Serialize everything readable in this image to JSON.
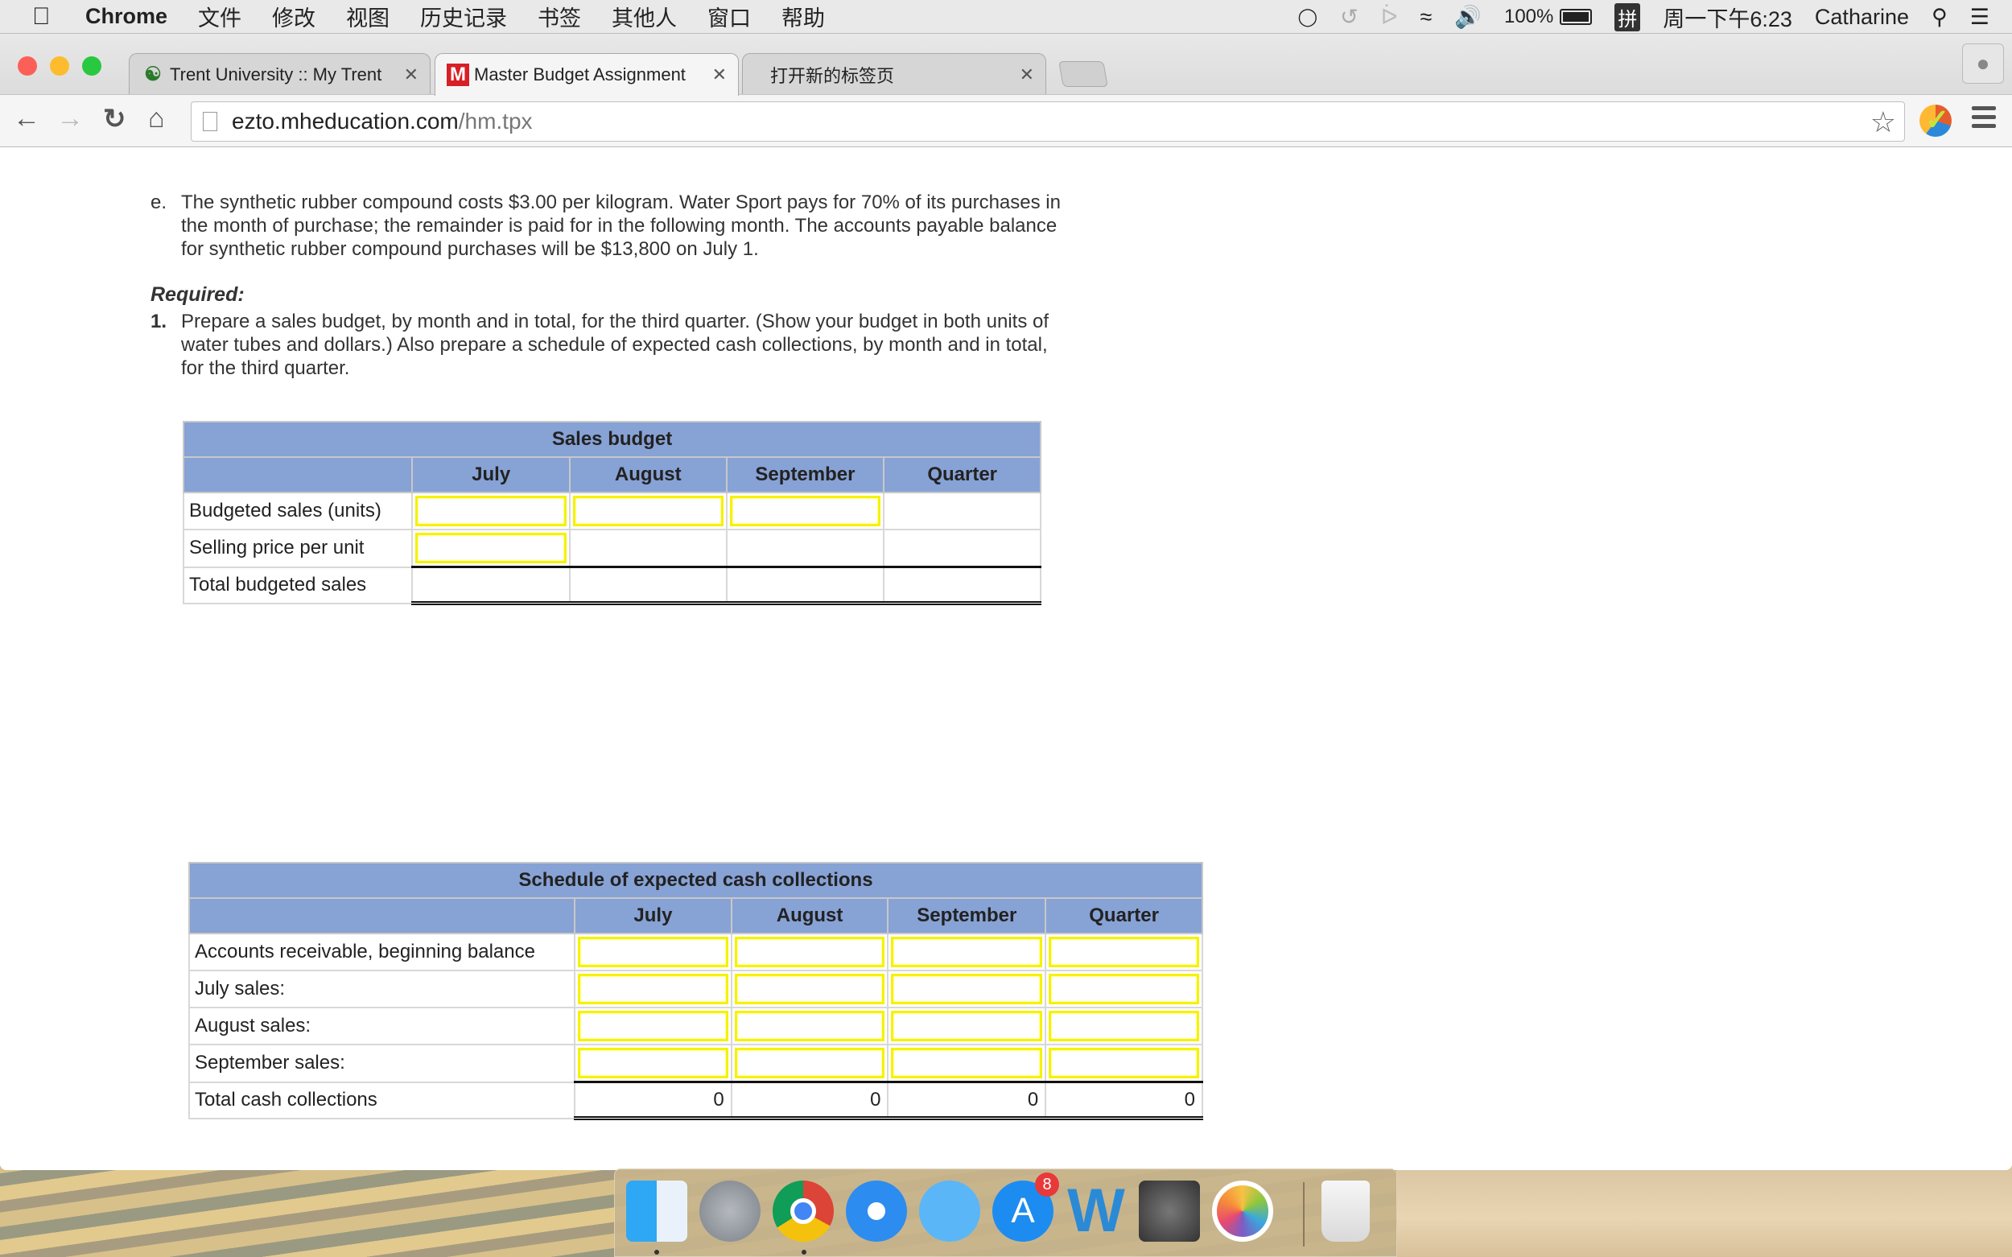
{
  "menubar": {
    "app": "Chrome",
    "items": [
      "文件",
      "修改",
      "视图",
      "历史记录",
      "书签",
      "其他人",
      "窗口",
      "帮助"
    ],
    "battery": "100%",
    "ime": "拼",
    "clock": "周一下午6:23",
    "user": "Catharine"
  },
  "tabs": [
    {
      "title": "Trent University :: My Trent",
      "favicon": "trent-logo-icon",
      "active": false
    },
    {
      "title": "Master Budget Assignment",
      "favicon": "M",
      "active": true
    },
    {
      "title": "打开新的标签页",
      "active": false
    }
  ],
  "omnibox": {
    "host": "ezto.mheducation.com",
    "path": "/hm.tpx"
  },
  "content": {
    "item_e_marker": "e.",
    "item_e_lines": [
      "The synthetic rubber compound costs $3.00 per kilogram. Water Sport pays for 70% of its purchases in",
      "the month of purchase; the remainder is paid for in the following month. The accounts payable balance",
      "for synthetic rubber compound purchases will be $13,800 on July 1."
    ],
    "required_label": "Required:",
    "req1_marker": "1.",
    "req1_lines": [
      "Prepare a sales budget, by month and in total, for the third quarter. (Show your budget in both units of",
      "water tubes and dollars.) Also prepare a schedule of expected cash collections, by month and in total,",
      "for the third quarter."
    ]
  },
  "sales_budget": {
    "title": "Sales budget",
    "columns": [
      "July",
      "August",
      "September",
      "Quarter"
    ],
    "rows": [
      {
        "label": "Budgeted sales (units)",
        "values": [
          "",
          "",
          "",
          ""
        ]
      },
      {
        "label": "Selling price per unit",
        "values": [
          "",
          "",
          "",
          ""
        ]
      },
      {
        "label": "Total budgeted sales",
        "values": [
          "",
          "",
          "",
          ""
        ]
      }
    ]
  },
  "cash_collections": {
    "title": "Schedule of expected cash collections",
    "columns": [
      "July",
      "August",
      "September",
      "Quarter"
    ],
    "rows": [
      {
        "label": "Accounts receivable, beginning balance",
        "values": [
          "",
          "",
          "",
          ""
        ]
      },
      {
        "label": "July sales:",
        "values": [
          "",
          "",
          "",
          ""
        ]
      },
      {
        "label": "August sales:",
        "values": [
          "",
          "",
          "",
          ""
        ]
      },
      {
        "label": "September sales:",
        "values": [
          "",
          "",
          "",
          ""
        ]
      },
      {
        "label": "Total cash collections",
        "values": [
          "0",
          "0",
          "0",
          "0"
        ]
      }
    ]
  },
  "dock": {
    "apps": [
      "Finder",
      "Launchpad",
      "Google Chrome",
      "Safari",
      "Messages",
      "App Store",
      "Microsoft Word",
      "System Preferences",
      "Photos",
      "Trash"
    ],
    "app_store_badge": "8"
  },
  "colors": {
    "table_header": "#87a2d5",
    "input_highlight": "#f5f20a"
  }
}
